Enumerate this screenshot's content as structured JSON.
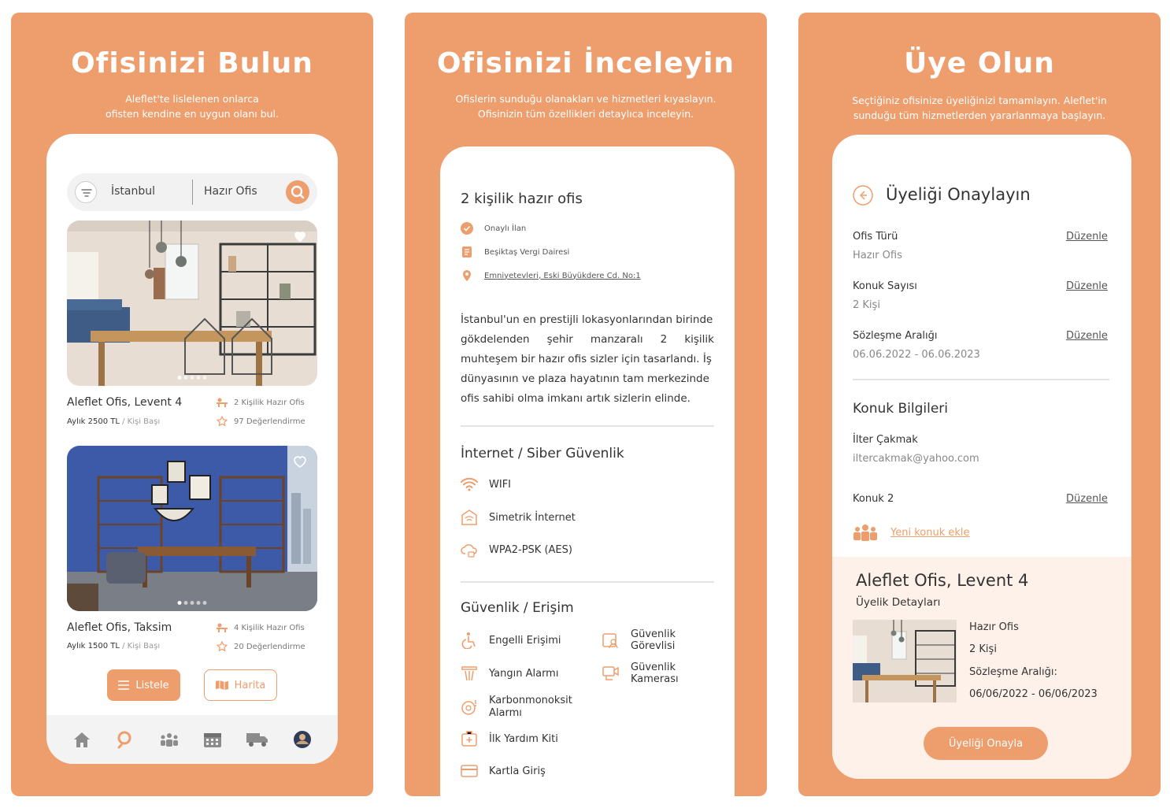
{
  "panel1": {
    "title": "Ofisinizi Bulun",
    "subtitle_line1": "Aleflet'te lislelenen onlarca",
    "subtitle_line2": "ofisten kendine en uygun olanı bul.",
    "search": {
      "city": "İstanbul",
      "type": "Hazır Ofis"
    },
    "listings": [
      {
        "name": "Aleflet Ofis, Levent 4",
        "price": "Aylık 2500 TL",
        "price_unit": "/ Kişi Başı",
        "capacity": "2 Kişilik Hazır Ofis",
        "reviews": "97 Değerlendirme"
      },
      {
        "name": "Aleflet Ofis, Taksim",
        "price": "Aylık 1500 TL",
        "price_unit": "/ Kişi Başı",
        "capacity": "4 Kişilik Hazır Ofis",
        "reviews": "20 Değerlendirme"
      }
    ],
    "btn_list": "Listele",
    "btn_map": "Harita",
    "tabs": [
      "home-icon",
      "search-icon",
      "team-icon",
      "calendar-icon",
      "truck-icon",
      "avatar"
    ]
  },
  "panel2": {
    "title": "Ofisinizi İnceleyin",
    "subtitle_line1": "Ofislerin sunduğu olanakları ve hizmetleri kıyaslayın.",
    "subtitle_line2": "Ofisinizin tüm özellikleri detaylıca inceleyin.",
    "office_title": "2 kişilik hazır ofis",
    "approved": "Onaylı İlan",
    "tax_office": "Beşiktaş Vergi Dairesi",
    "address": "Emniyetevleri, Eski Büyükdere Cd. No:1",
    "desc_lines": [
      "İstanbul'un en prestijli lokasyonlarından birinde",
      "gökdelenden şehir manzaralı 2 kişilik",
      "muhteşem bir hazır ofis sizler için tasarlandı. İş",
      "dünyasının ve plaza hayatının tam merkezinde",
      "ofis sahibi olma imkanı artık sizlerin elinde."
    ],
    "internet_title": "İnternet / Siber Güvenlik",
    "internet_items": [
      "WIFI",
      "Simetrik İnternet",
      "WPA2-PSK (AES)"
    ],
    "security_title": "Güvenlik / Erişim",
    "security_left": [
      "Engelli Erişimi",
      "Yangın Alarmı",
      "Karbonmonoksit Alarmı",
      "İlk Yardım Kiti",
      "Kartla Giriş"
    ],
    "security_right": [
      "Güvenlik Görevlisi",
      "Güvenlik Kamerası"
    ]
  },
  "panel3": {
    "title": "Üye Olun",
    "subtitle_line1": "Seçtiğiniz ofisinize üyeliğinizi tamamlayın. Aleflet'in",
    "subtitle_line2": "sunduğu tüm hizmetlerden yararlanmaya başlayın.",
    "header": "Üyeliği Onaylayın",
    "fields": [
      {
        "label": "Ofis Türü",
        "value": "Hazır Ofis"
      },
      {
        "label": "Konuk Sayısı",
        "value": "2 Kişi"
      },
      {
        "label": "Sözleşme Aralığı",
        "value": "06.06.2022 - 06.06.2023"
      }
    ],
    "edit_label": "Düzenle",
    "guest_title": "Konuk Bilgileri",
    "guest_name": "İlter Çakmak",
    "guest_email": "iltercakmak@yahoo.com",
    "guest2": "Konuk 2",
    "add_guest": "Yeni konuk ekle",
    "office_name": "Aleflet Ofis, Levent 4",
    "membership_details": "Üyelik Detayları",
    "detail_type": "Hazır Ofis",
    "detail_people": "2 Kişi",
    "detail_range_label": "Sözleşme Aralığı:",
    "detail_range": "06/06/2022 - 06/06/2023",
    "confirm_button": "Üyeliği Onayla"
  },
  "colors": {
    "accent": "#EE9D6C",
    "accent_dark": "#EE8A4E",
    "detail_bg": "#FDF1EA"
  }
}
